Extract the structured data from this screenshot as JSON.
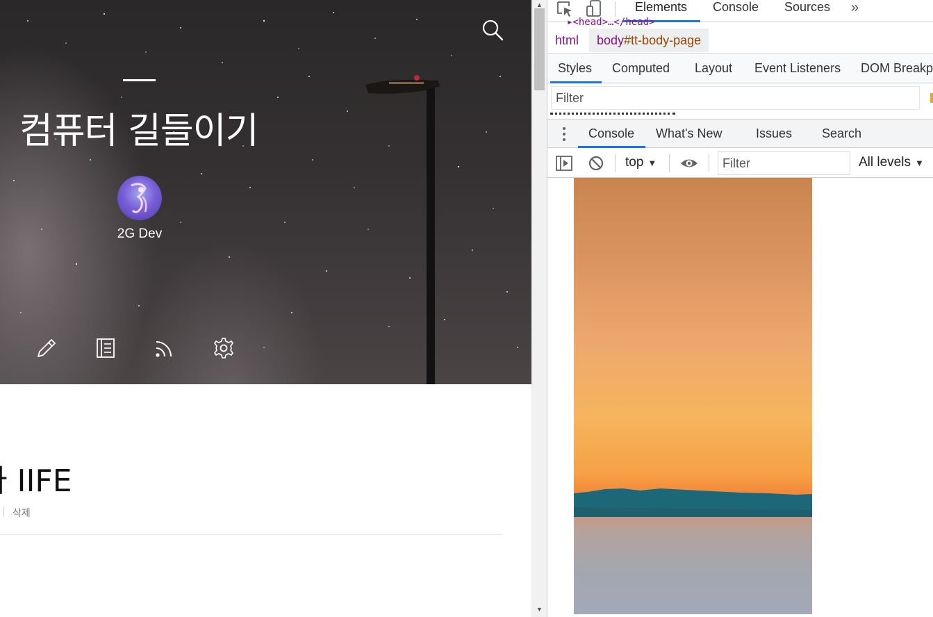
{
  "blog": {
    "title": "컴퓨터 길들이기",
    "author": "2G Dev",
    "post": {
      "title_visible": "라 IIFE",
      "delete_label": "삭제"
    },
    "icons": {
      "search": "search-icon",
      "write": "pencil-icon",
      "manage": "notebook-icon",
      "rss": "rss-icon",
      "settings": "gear-icon"
    }
  },
  "devtools": {
    "main_tabs": [
      {
        "label": "Elements",
        "active": true
      },
      {
        "label": "Console",
        "active": false
      },
      {
        "label": "Sources",
        "active": false
      }
    ],
    "more_tabs": "»",
    "head_peek": "▸<head>…</head>",
    "breadcrumb": {
      "html": "html",
      "body_tag": "body",
      "body_id": "#tt-body-page"
    },
    "style_tabs": [
      "Styles",
      "Computed",
      "Layout",
      "Event Listeners",
      "DOM Breakpoints"
    ],
    "styles_filter_placeholder": "Filter",
    "drawer_tabs": [
      "Console",
      "What's New",
      "Issues",
      "Search"
    ],
    "console_toolbar": {
      "context": "top",
      "filter_placeholder": "Filter",
      "levels": "All levels"
    },
    "colors": {
      "accent": "#1a73e8",
      "tag": "#881280",
      "attr": "#994500"
    }
  }
}
